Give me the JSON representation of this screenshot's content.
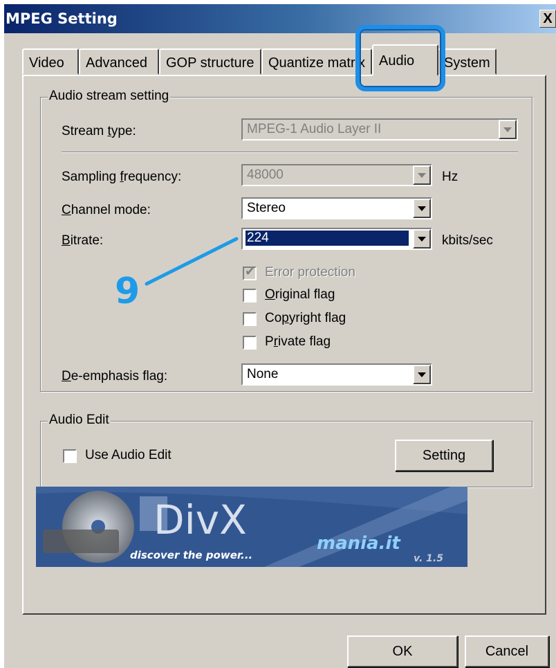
{
  "window": {
    "title": "MPEG Setting",
    "close_label": "X"
  },
  "tabs": [
    {
      "label": "Video"
    },
    {
      "label": "Advanced"
    },
    {
      "label": "GOP structure"
    },
    {
      "label": "Quantize matrix"
    },
    {
      "label": "Audio",
      "active": true
    },
    {
      "label": "System"
    }
  ],
  "audio_stream": {
    "group_title": "Audio stream setting",
    "stream_type": {
      "label": "Stream type:",
      "value": "MPEG-1 Audio Layer II"
    },
    "sampling": {
      "label": "Sampling frequency:",
      "value": "48000",
      "unit": "Hz"
    },
    "channel_mode": {
      "label": "Channel mode:",
      "value": "Stereo"
    },
    "bitrate": {
      "label": "Bitrate:",
      "value": "224",
      "unit": "kbits/sec"
    },
    "checkboxes": {
      "error_protection": {
        "label": "Error protection",
        "checked": true,
        "enabled": false
      },
      "original": {
        "label": "Original flag",
        "checked": false
      },
      "copyright": {
        "label": "Copyright flag",
        "checked": false
      },
      "private": {
        "label": "Private flag",
        "checked": false
      }
    },
    "deemphasis": {
      "label": "De-emphasis flag:",
      "value": "None"
    }
  },
  "audio_edit": {
    "group_title": "Audio Edit",
    "use_label": "Use Audio Edit",
    "setting_button": "Setting"
  },
  "banner": {
    "logo": "DivX",
    "tagline": "discover the power...",
    "site": "mania.it",
    "version": "v. 1.5"
  },
  "annotation": {
    "number": "9",
    "color": "#1e9be8"
  },
  "footer": {
    "ok": "OK",
    "cancel": "Cancel"
  },
  "colors": {
    "face": "#d4d0c8",
    "title_start": "#0a246a",
    "highlight_ring": "#1e8fe8"
  }
}
